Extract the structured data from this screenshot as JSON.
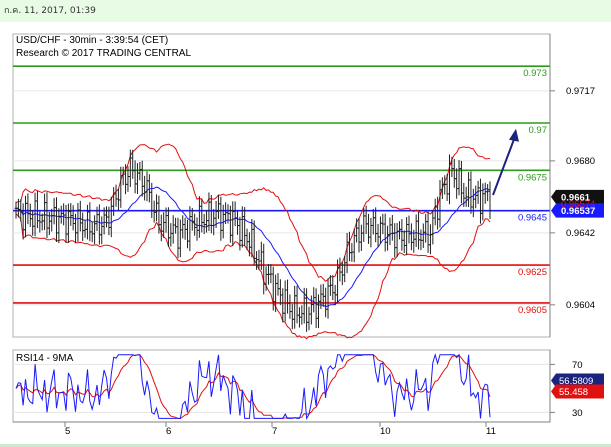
{
  "header": {
    "date_text": "ก.ค. 11, 2017, 01:39"
  },
  "chart_data": {
    "type": "line",
    "instrument_title": "USD/CHF - 30min - 3:39:54 (CET)",
    "research_line": "Research © 2017 TRADING CENTRAL",
    "price_panel": {
      "ylim": [
        0.9587,
        0.9747
      ],
      "yticks": [
        "0.9717",
        "0.9680",
        "0.9642",
        "0.9604"
      ],
      "x_tick_labels": [
        "5",
        "6",
        "7",
        "10",
        "11"
      ],
      "current_price": "0.9661",
      "ma_value": "0.96574",
      "blue_line_value": "0.96537",
      "levels": [
        {
          "value": 0.973,
          "label": "0.973",
          "color": "#2e9a1e"
        },
        {
          "value": 0.97,
          "label": "0.97",
          "color": "#2e9a1e"
        },
        {
          "value": 0.9675,
          "label": "0.9675",
          "color": "#2e9a1e"
        },
        {
          "value": 0.96537,
          "label": "0.9645",
          "color": "#1a1aff"
        },
        {
          "value": 0.9625,
          "label": "0.9625",
          "color": "#e01010"
        },
        {
          "value": 0.9605,
          "label": "0.9605",
          "color": "#e01010"
        }
      ],
      "arrow": {
        "from_value": 0.9662,
        "to_value": 0.9697,
        "color": "#1a237e"
      }
    },
    "rsi_panel": {
      "title": "RSI14 - 9MA",
      "yticks": [
        "70",
        "30"
      ],
      "ylim": [
        22,
        82
      ],
      "rsi_value": "56.5809",
      "ma_value": "55.458"
    },
    "colors": {
      "price": "#202020",
      "ma_blue": "#1a1aff",
      "bollinger_red": "#e01010",
      "rsi_line": "#1a1aff",
      "rsi_ma": "#e01010",
      "current_badge": "#111111",
      "blue_badge": "#1a1aff",
      "rsi_badge": "#1a237e",
      "rsi_ma_badge": "#e01010"
    }
  }
}
